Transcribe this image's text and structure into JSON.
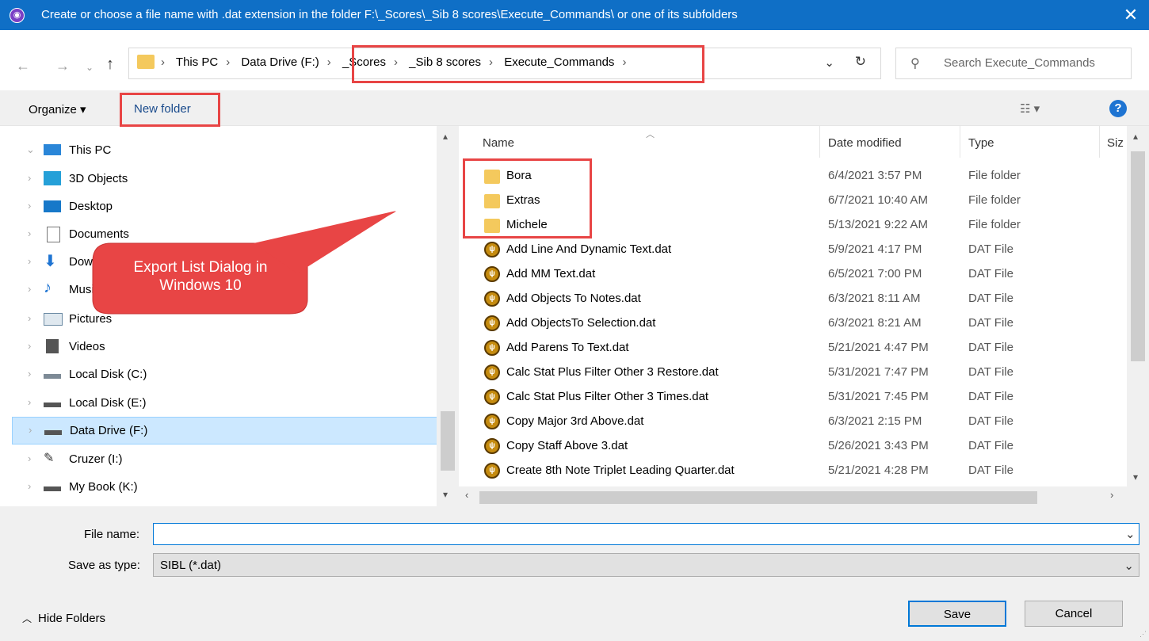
{
  "titlebar": {
    "title": "Create or choose a file name with .dat extension in the folder F:\\_Scores\\_Sib 8 scores\\Execute_Commands\\ or one of its subfolders",
    "close_glyph": "✕"
  },
  "address": {
    "crumbs": [
      "This PC",
      "Data Drive (F:)",
      "_Scores",
      "_Sib 8 scores",
      "Execute_Commands"
    ],
    "search_placeholder": "Search Execute_Commands"
  },
  "toolbar": {
    "organize_label": "Organize ▾",
    "new_folder_label": "New folder"
  },
  "nav": {
    "items": [
      {
        "label": "This PC",
        "icon": "monitor-icon"
      },
      {
        "label": "3D Objects",
        "icon": "cube-icon"
      },
      {
        "label": "Desktop",
        "icon": "desktop-icon"
      },
      {
        "label": "Documents",
        "icon": "document-icon"
      },
      {
        "label": "Downloads",
        "icon": "download-icon"
      },
      {
        "label": "Music",
        "icon": "music-icon"
      },
      {
        "label": "Pictures",
        "icon": "picture-icon"
      },
      {
        "label": "Videos",
        "icon": "video-icon"
      },
      {
        "label": "Local Disk (C:)",
        "icon": "drive-icon"
      },
      {
        "label": "Local Disk (E:)",
        "icon": "drive-icon"
      },
      {
        "label": "Data Drive (F:)",
        "icon": "drive-icon"
      },
      {
        "label": "Cruzer (I:)",
        "icon": "usb-icon"
      },
      {
        "label": "My Book (K:)",
        "icon": "drive-icon"
      }
    ],
    "selected_index": 10
  },
  "files": {
    "columns": {
      "name": "Name",
      "date": "Date modified",
      "type": "Type",
      "size": "Siz"
    },
    "rows": [
      {
        "name": "Bora",
        "date": "6/4/2021 3:57 PM",
        "type": "File folder",
        "kind": "folder"
      },
      {
        "name": "Extras",
        "date": "6/7/2021 10:40 AM",
        "type": "File folder",
        "kind": "folder"
      },
      {
        "name": "Michele",
        "date": "5/13/2021 9:22 AM",
        "type": "File folder",
        "kind": "folder"
      },
      {
        "name": "Add Line And Dynamic Text.dat",
        "date": "5/9/2021 4:17 PM",
        "type": "DAT File",
        "kind": "dat"
      },
      {
        "name": "Add MM Text.dat",
        "date": "6/5/2021 7:00 PM",
        "type": "DAT File",
        "kind": "dat"
      },
      {
        "name": "Add Objects To Notes.dat",
        "date": "6/3/2021 8:11 AM",
        "type": "DAT File",
        "kind": "dat"
      },
      {
        "name": "Add ObjectsTo Selection.dat",
        "date": "6/3/2021 8:21 AM",
        "type": "DAT File",
        "kind": "dat"
      },
      {
        "name": "Add Parens To Text.dat",
        "date": "5/21/2021 4:47 PM",
        "type": "DAT File",
        "kind": "dat"
      },
      {
        "name": "Calc Stat Plus Filter Other 3 Restore.dat",
        "date": "5/31/2021 7:47 PM",
        "type": "DAT File",
        "kind": "dat"
      },
      {
        "name": "Calc Stat Plus Filter Other 3 Times.dat",
        "date": "5/31/2021 7:45 PM",
        "type": "DAT File",
        "kind": "dat"
      },
      {
        "name": "Copy Major 3rd Above.dat",
        "date": "6/3/2021 2:15 PM",
        "type": "DAT File",
        "kind": "dat"
      },
      {
        "name": "Copy Staff Above 3.dat",
        "date": "5/26/2021 3:43 PM",
        "type": "DAT File",
        "kind": "dat"
      },
      {
        "name": "Create 8th Note Triplet Leading Quarter.dat",
        "date": "5/21/2021 4:28 PM",
        "type": "DAT File",
        "kind": "dat"
      }
    ]
  },
  "bottom": {
    "file_name_label": "File name:",
    "file_name_value": "",
    "save_type_label": "Save as type:",
    "save_type_value": "SIBL (*.dat)",
    "hide_folders_label": "Hide Folders",
    "save_label": "Save",
    "cancel_label": "Cancel"
  },
  "annotation": {
    "callout_line1": "Export List Dialog in",
    "callout_line2": "Windows 10",
    "color": "#e84545"
  }
}
